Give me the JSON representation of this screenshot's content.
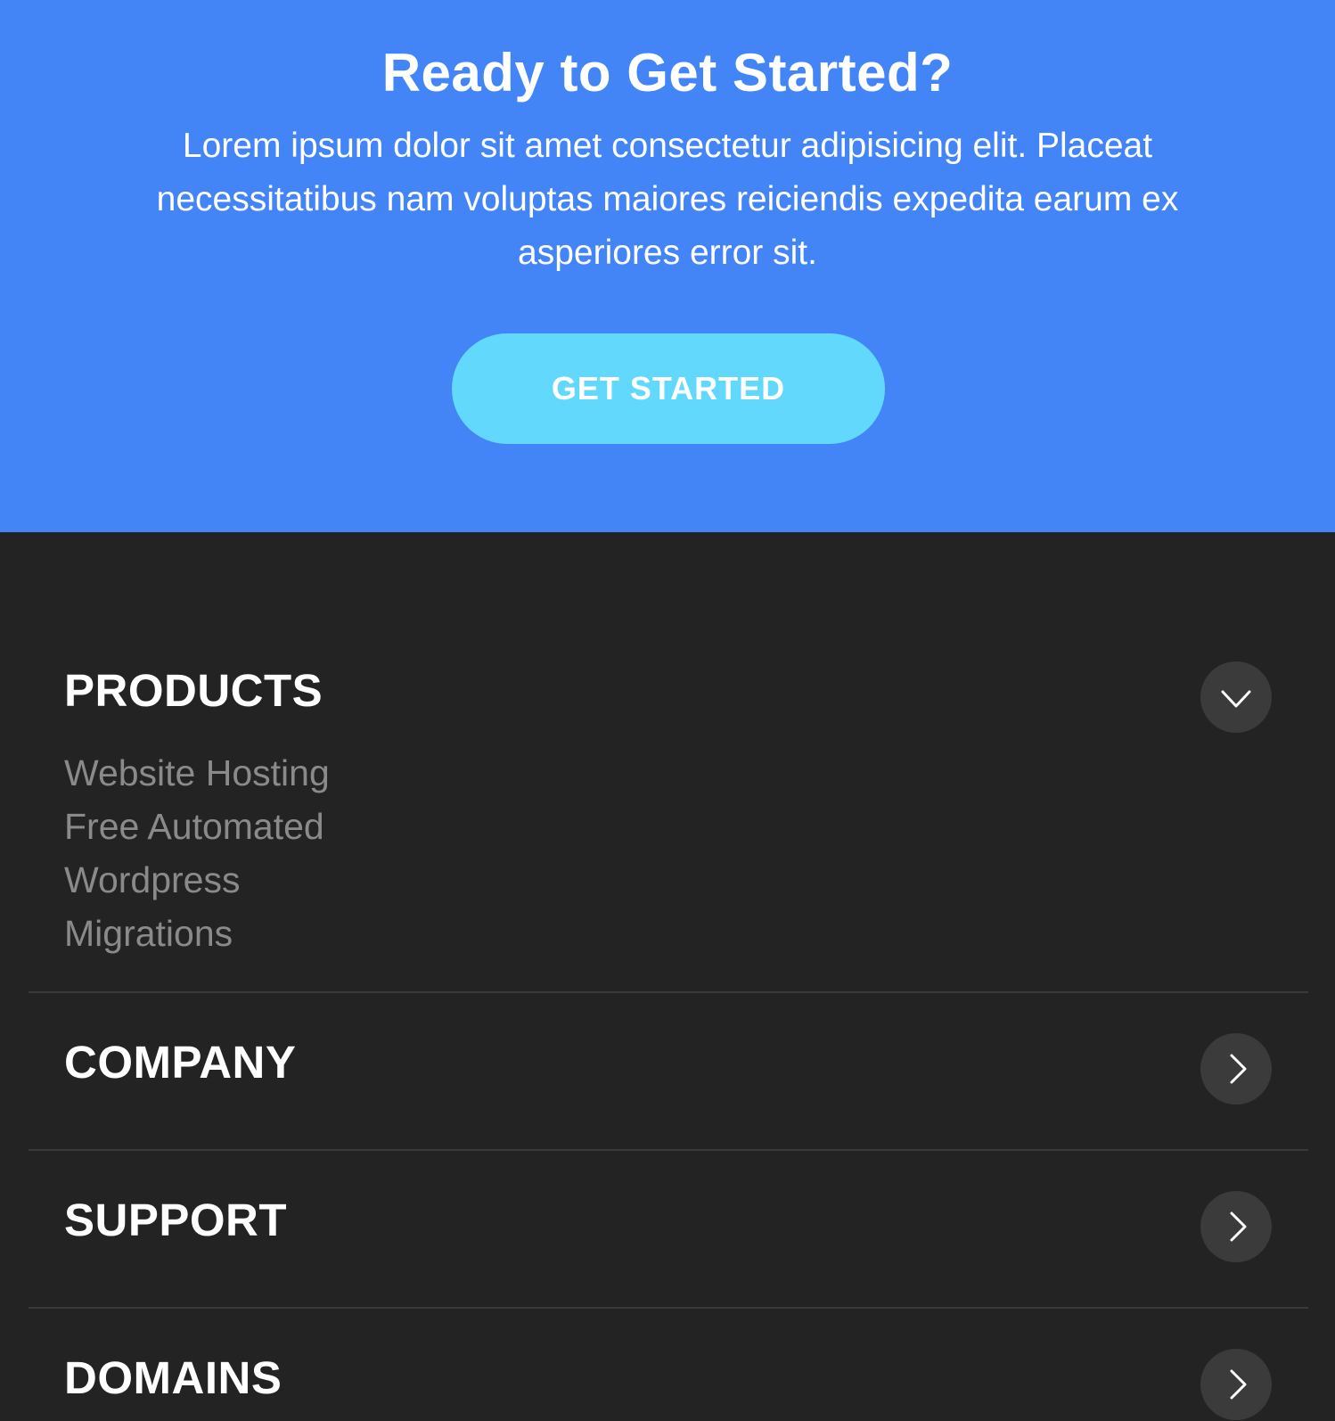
{
  "cta": {
    "title": "Ready to Get Started?",
    "text": "Lorem ipsum dolor sit amet consectetur adipisicing elit. Placeat necessitatibus nam voluptas maiores reiciendis expedita earum ex asperiores error sit.",
    "button_label": "GET STARTED",
    "background_color": "#4385f7",
    "button_color": "#62d9fc"
  },
  "footer": {
    "background_color": "#232323",
    "sections": [
      {
        "title": "PRODUCTS",
        "expanded": true,
        "toggle_icon": "chevron-down-icon",
        "links": [
          "Website Hosting",
          "Free Automated",
          "Wordpress",
          "Migrations"
        ]
      },
      {
        "title": "COMPANY",
        "expanded": false,
        "toggle_icon": "chevron-right-icon"
      },
      {
        "title": "SUPPORT",
        "expanded": false,
        "toggle_icon": "chevron-right-icon"
      },
      {
        "title": "DOMAINS",
        "expanded": false,
        "toggle_icon": "chevron-right-icon"
      }
    ]
  }
}
